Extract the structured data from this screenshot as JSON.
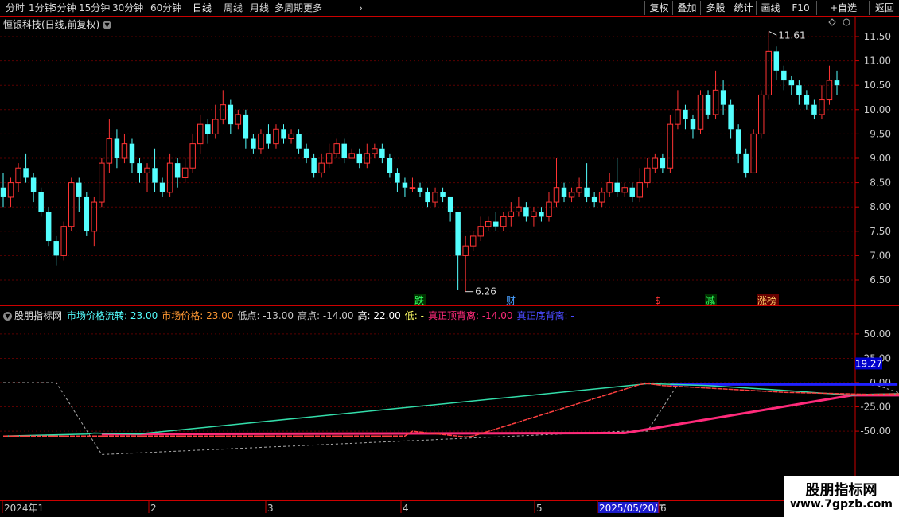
{
  "toolbar": {
    "periods": [
      "分时",
      "1分钟",
      "5分钟",
      "15分钟",
      "30分钟",
      "60分钟",
      "日线",
      "周线",
      "月线",
      "多周期",
      "更多"
    ],
    "active_period": "日线",
    "right_buttons": [
      "复权",
      "叠加",
      "多股",
      "统计",
      "画线",
      "F10",
      "+自选",
      "返回"
    ]
  },
  "colors": {
    "up": "#ff3333",
    "down": "#54ffff",
    "pink": "#ff2a7a",
    "blue": "#2020ff",
    "green": "#30ff60",
    "grid": "#5a0000",
    "axis": "#cc0000"
  },
  "main": {
    "title": "恒银科技(日线,前复权)",
    "price_high_label": "11.61",
    "price_low_label": "6.26",
    "events": [
      {
        "text": "跌",
        "color": "#30ff60",
        "bg": "#003300"
      },
      {
        "text": "财",
        "color": "#4aa0ff",
        "bg": "#000"
      },
      {
        "text": "$",
        "color": "#ff3333",
        "bg": "#000"
      },
      {
        "text": "减",
        "color": "#30ff60",
        "bg": "#003300"
      },
      {
        "text": "涨榜",
        "color": "#ffcc66",
        "bg": "#660000"
      }
    ]
  },
  "indicator": {
    "name": "股朋指标网",
    "fields": [
      {
        "text": "市场价格流转: 23.00",
        "color": "#54ffff"
      },
      {
        "text": "市场价格: 23.00",
        "color": "#ff9933"
      },
      {
        "text": "低点: -13.00",
        "color": "#c8c8c8"
      },
      {
        "text": "高点: -14.00",
        "color": "#c8c8c8"
      },
      {
        "text": "高: 22.00",
        "color": "#ffffff"
      },
      {
        "text": "低: -",
        "color": "#ffff66"
      },
      {
        "text": "真正顶背离: -14.00",
        "color": "#ff2a7a"
      },
      {
        "text": "真正底背离: -",
        "color": "#4a4aff"
      }
    ],
    "value_label": "19.27"
  },
  "xaxis": {
    "labels": [
      "2024年1",
      "2",
      "3",
      "4",
      "5",
      "2025/05/20/二",
      "6"
    ]
  },
  "brand": {
    "name": "股朋指标网",
    "url": "www.7gpzb.com"
  },
  "chart_data": [
    {
      "type": "candlestick",
      "title": "恒银科技(日线,前复权)",
      "ylim": [
        6.2,
        11.8
      ],
      "yticks": [
        6.5,
        7.0,
        7.5,
        8.0,
        8.5,
        9.0,
        9.5,
        10.0,
        10.5,
        11.0,
        11.5
      ],
      "x_labels": [
        "2024年1",
        "2",
        "3",
        "4",
        "5",
        "6"
      ],
      "max_label": 11.61,
      "min_label": 6.26,
      "candles": [
        [
          8.4,
          8.2,
          8.7,
          8.0
        ],
        [
          8.2,
          8.5,
          8.6,
          8.0
        ],
        [
          8.5,
          8.8,
          8.9,
          8.3
        ],
        [
          8.8,
          8.6,
          9.1,
          8.5
        ],
        [
          8.6,
          8.3,
          8.7,
          8.1
        ],
        [
          8.3,
          7.9,
          8.4,
          7.8
        ],
        [
          7.9,
          7.3,
          8.0,
          7.2
        ],
        [
          7.3,
          7.0,
          7.4,
          6.8
        ],
        [
          7.0,
          7.6,
          7.7,
          6.9
        ],
        [
          7.6,
          8.5,
          8.6,
          7.5
        ],
        [
          8.5,
          8.2,
          8.6,
          7.9
        ],
        [
          8.2,
          7.5,
          8.3,
          7.4
        ],
        [
          7.5,
          8.1,
          8.2,
          7.2
        ],
        [
          8.1,
          8.9,
          9.0,
          8.0
        ],
        [
          8.9,
          9.4,
          9.8,
          8.7
        ],
        [
          9.4,
          9.0,
          9.6,
          8.8
        ],
        [
          9.0,
          9.3,
          9.5,
          8.9
        ],
        [
          9.3,
          8.9,
          9.4,
          8.7
        ],
        [
          8.9,
          8.7,
          9.0,
          8.5
        ],
        [
          8.7,
          8.8,
          8.9,
          8.3
        ],
        [
          8.8,
          8.5,
          9.2,
          8.3
        ],
        [
          8.5,
          8.3,
          8.6,
          8.2
        ],
        [
          8.3,
          8.9,
          9.1,
          8.2
        ],
        [
          8.9,
          8.6,
          9.0,
          8.4
        ],
        [
          8.6,
          8.8,
          9.0,
          8.5
        ],
        [
          8.8,
          9.3,
          9.5,
          8.7
        ],
        [
          9.3,
          9.7,
          9.9,
          9.1
        ],
        [
          9.7,
          9.5,
          9.8,
          9.3
        ],
        [
          9.5,
          9.8,
          10.1,
          9.4
        ],
        [
          9.8,
          10.1,
          10.4,
          9.7
        ],
        [
          10.1,
          9.7,
          10.2,
          9.5
        ],
        [
          9.7,
          9.9,
          10.0,
          9.6
        ],
        [
          9.9,
          9.4,
          10.0,
          9.2
        ],
        [
          9.4,
          9.2,
          9.5,
          9.1
        ],
        [
          9.2,
          9.5,
          9.6,
          9.1
        ],
        [
          9.5,
          9.3,
          9.7,
          9.2
        ],
        [
          9.3,
          9.6,
          9.7,
          9.2
        ],
        [
          9.6,
          9.4,
          9.7,
          9.3
        ],
        [
          9.4,
          9.5,
          9.6,
          9.3
        ],
        [
          9.5,
          9.2,
          9.6,
          9.1
        ],
        [
          9.2,
          9.0,
          9.3,
          8.9
        ],
        [
          9.0,
          8.7,
          9.1,
          8.6
        ],
        [
          8.7,
          8.9,
          9.1,
          8.6
        ],
        [
          8.9,
          9.1,
          9.3,
          8.8
        ],
        [
          9.1,
          9.3,
          9.4,
          9.0
        ],
        [
          9.3,
          9.0,
          9.4,
          8.9
        ],
        [
          9.0,
          9.1,
          9.2,
          9.0
        ],
        [
          9.1,
          8.9,
          9.2,
          8.8
        ],
        [
          8.9,
          9.1,
          9.3,
          8.8
        ],
        [
          9.1,
          9.2,
          9.3,
          9.0
        ],
        [
          9.2,
          9.0,
          9.3,
          8.9
        ],
        [
          9.0,
          8.7,
          9.1,
          8.6
        ],
        [
          8.7,
          8.5,
          8.8,
          8.3
        ],
        [
          8.5,
          8.4,
          8.6,
          8.2
        ],
        [
          8.4,
          8.4,
          8.6,
          8.3
        ],
        [
          8.4,
          8.3,
          8.5,
          8.2
        ],
        [
          8.3,
          8.1,
          8.4,
          8.0
        ],
        [
          8.1,
          8.3,
          8.4,
          8.0
        ],
        [
          8.3,
          8.2,
          8.4,
          8.1
        ],
        [
          8.2,
          7.9,
          8.2,
          7.7
        ],
        [
          7.9,
          7.0,
          7.9,
          6.3
        ],
        [
          7.0,
          7.2,
          7.4,
          6.26
        ],
        [
          7.2,
          7.4,
          7.5,
          7.1
        ],
        [
          7.4,
          7.6,
          7.8,
          7.3
        ],
        [
          7.6,
          7.7,
          7.8,
          7.5
        ],
        [
          7.7,
          7.6,
          7.9,
          7.5
        ],
        [
          7.6,
          7.8,
          7.9,
          7.5
        ],
        [
          7.8,
          7.9,
          8.1,
          7.6
        ],
        [
          7.9,
          8.0,
          8.2,
          7.8
        ],
        [
          8.0,
          7.8,
          8.1,
          7.7
        ],
        [
          7.8,
          7.9,
          8.0,
          7.6
        ],
        [
          7.9,
          7.8,
          8.0,
          7.7
        ],
        [
          7.8,
          8.1,
          8.3,
          7.7
        ],
        [
          8.1,
          8.4,
          9.0,
          8.0
        ],
        [
          8.4,
          8.2,
          8.5,
          8.1
        ],
        [
          8.2,
          8.3,
          8.4,
          8.1
        ],
        [
          8.3,
          8.4,
          8.6,
          8.2
        ],
        [
          8.4,
          8.2,
          8.9,
          8.1
        ],
        [
          8.2,
          8.1,
          8.3,
          8.0
        ],
        [
          8.1,
          8.3,
          8.4,
          8.0
        ],
        [
          8.3,
          8.5,
          8.7,
          8.2
        ],
        [
          8.5,
          8.3,
          9.0,
          8.2
        ],
        [
          8.3,
          8.4,
          8.5,
          8.2
        ],
        [
          8.4,
          8.2,
          8.5,
          8.1
        ],
        [
          8.2,
          8.5,
          8.8,
          8.1
        ],
        [
          8.5,
          8.8,
          9.0,
          8.4
        ],
        [
          8.8,
          9.0,
          9.1,
          8.7
        ],
        [
          9.0,
          8.8,
          9.1,
          8.7
        ],
        [
          8.8,
          9.7,
          9.9,
          8.7
        ],
        [
          9.7,
          10.0,
          10.4,
          9.6
        ],
        [
          10.0,
          9.8,
          10.1,
          9.6
        ],
        [
          9.8,
          9.6,
          9.9,
          9.4
        ],
        [
          9.6,
          10.3,
          10.4,
          9.5
        ],
        [
          10.3,
          9.9,
          10.4,
          9.8
        ],
        [
          9.9,
          10.4,
          10.8,
          9.8
        ],
        [
          10.4,
          10.1,
          10.6,
          9.9
        ],
        [
          10.1,
          9.6,
          10.2,
          9.4
        ],
        [
          9.6,
          9.1,
          9.7,
          8.9
        ],
        [
          9.1,
          8.7,
          9.2,
          8.6
        ],
        [
          8.7,
          9.5,
          9.6,
          8.7
        ],
        [
          9.5,
          10.3,
          10.4,
          9.4
        ],
        [
          10.3,
          11.2,
          11.61,
          10.2
        ],
        [
          11.2,
          10.8,
          11.3,
          10.6
        ],
        [
          10.8,
          10.6,
          10.9,
          10.4
        ],
        [
          10.6,
          10.5,
          10.7,
          10.3
        ],
        [
          10.5,
          10.3,
          10.6,
          10.1
        ],
        [
          10.3,
          10.1,
          10.4,
          10.0
        ],
        [
          10.1,
          9.9,
          10.2,
          9.8
        ],
        [
          9.9,
          10.2,
          10.5,
          9.8
        ],
        [
          10.2,
          10.6,
          10.9,
          10.1
        ],
        [
          10.6,
          10.5,
          10.8,
          10.3
        ]
      ]
    },
    {
      "type": "line",
      "title": "股朋指标网",
      "ylim": [
        -80,
        80
      ],
      "yticks": [
        50.0,
        25.0,
        0.0,
        -25.0,
        -50.0
      ],
      "series": [
        {
          "name": "市场价格流转",
          "x": [
            0,
            11,
            12,
            18,
            19,
            84,
            85,
            93,
            103,
            112,
            114,
            121,
            167
          ],
          "y": [
            -55,
            -53,
            -52,
            -53,
            -52,
            -2,
            -1,
            -3,
            -8,
            -13,
            -12,
            -11,
            20
          ]
        },
        {
          "name": "市场价格",
          "x": [
            0,
            53,
            54,
            61,
            62,
            84,
            85,
            87,
            103,
            114,
            123,
            167
          ],
          "y": [
            -55,
            -55,
            -50,
            -56,
            -55,
            -2,
            -1,
            -3,
            -10,
            -12,
            -11,
            19.27
          ]
        },
        {
          "name": "高点",
          "x": [
            0,
            7,
            13,
            82,
            85,
            89,
            115,
            118,
            120,
            167
          ],
          "y": [
            0,
            0,
            -74,
            -50,
            -50,
            -2,
            -2,
            -10,
            -13,
            -11
          ]
        },
        {
          "name": "真正顶背离",
          "x": [
            13,
            82,
            112,
            120,
            121,
            166
          ],
          "y": [
            -53,
            -52,
            -13,
            -13,
            -14,
            -14
          ]
        },
        {
          "name": "真正底背离",
          "x": [
            88,
            118
          ],
          "y": [
            -2,
            -2
          ]
        }
      ]
    }
  ]
}
